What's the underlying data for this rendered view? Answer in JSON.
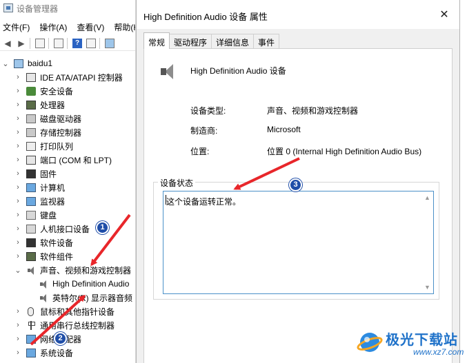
{
  "device_manager": {
    "title": "设备管理器",
    "menu": [
      "文件(F)",
      "操作(A)",
      "查看(V)",
      "帮助(H)"
    ],
    "tree": {
      "root": "baidu1",
      "items": [
        {
          "label": "IDE ATA/ATAPI 控制器",
          "icon": "ide-controller-icon",
          "expanded": false
        },
        {
          "label": "安全设备",
          "icon": "security-device-icon",
          "expanded": false
        },
        {
          "label": "处理器",
          "icon": "processor-icon",
          "expanded": false
        },
        {
          "label": "磁盘驱动器",
          "icon": "disk-drive-icon",
          "expanded": false
        },
        {
          "label": "存储控制器",
          "icon": "storage-controller-icon",
          "expanded": false
        },
        {
          "label": "打印队列",
          "icon": "printer-icon",
          "expanded": false
        },
        {
          "label": "端口 (COM 和 LPT)",
          "icon": "port-icon",
          "expanded": false
        },
        {
          "label": "固件",
          "icon": "firmware-icon",
          "expanded": false
        },
        {
          "label": "计算机",
          "icon": "computer-icon",
          "expanded": false
        },
        {
          "label": "监视器",
          "icon": "monitor-icon",
          "expanded": false
        },
        {
          "label": "键盘",
          "icon": "keyboard-icon",
          "expanded": false
        },
        {
          "label": "人机接口设备",
          "icon": "hid-icon",
          "expanded": false
        },
        {
          "label": "软件设备",
          "icon": "software-device-icon",
          "expanded": false
        },
        {
          "label": "软件组件",
          "icon": "software-component-icon",
          "expanded": false
        },
        {
          "label": "声音、视频和游戏控制器",
          "icon": "speaker-icon",
          "expanded": true
        },
        {
          "label": "High Definition Audio",
          "icon": "speaker-icon",
          "child": true
        },
        {
          "label": "英特尔(R) 显示器音频",
          "icon": "speaker-icon",
          "child": true
        },
        {
          "label": "鼠标和其他指针设备",
          "icon": "mouse-icon",
          "expanded": false
        },
        {
          "label": "通用串行总线控制器",
          "icon": "usb-icon",
          "expanded": false
        },
        {
          "label": "网络适配器",
          "icon": "network-adapter-icon",
          "expanded": false
        },
        {
          "label": "系统设备",
          "icon": "system-device-icon",
          "expanded": false
        }
      ]
    }
  },
  "dialog": {
    "title": "High Definition Audio 设备 属性",
    "close": "✕",
    "tabs": [
      {
        "label": "常规",
        "active": true
      },
      {
        "label": "驱动程序",
        "active": false
      },
      {
        "label": "详细信息",
        "active": false
      },
      {
        "label": "事件",
        "active": false
      }
    ],
    "device_name": "High Definition Audio 设备",
    "properties": [
      {
        "label": "设备类型:",
        "value": "声音、视频和游戏控制器"
      },
      {
        "label": "制造商:",
        "value": "Microsoft"
      },
      {
        "label": "位置:",
        "value": "位置 0 (Internal High Definition Audio Bus)"
      }
    ],
    "status_group_label": "设备状态",
    "status_text": "这个设备运转正常。"
  },
  "annotations": {
    "badges": [
      "1",
      "2",
      "3"
    ],
    "color": "#e8262a",
    "badge_color": "#1f4ea8"
  },
  "watermark": {
    "name": "极光下载站",
    "url": "www.xz7.com"
  }
}
